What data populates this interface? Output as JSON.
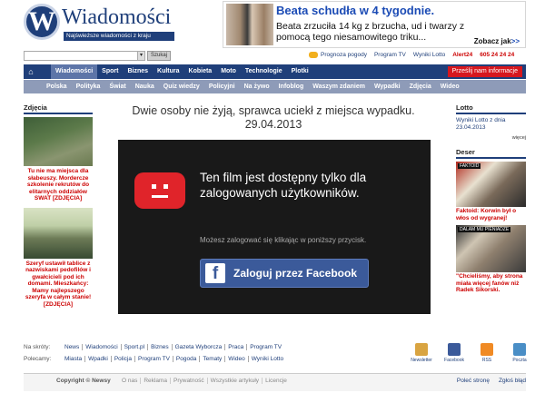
{
  "logo": {
    "letter": "W",
    "name": "Wiadomości",
    "tagline": "Najświeższe wiadomości z kraju"
  },
  "ad": {
    "title": "Beata schudła w 4 tygodnie.",
    "text": "Beata zrzuciła 14 kg z brzucha, ud i twarzy z pomocą tego niesamowitego triku...",
    "more_label": "Zobacz jak",
    "more_arrow": ">>"
  },
  "search": {
    "value": "",
    "button": "Szukaj",
    "dropdown_arrow": "▾"
  },
  "toplinks": [
    "Prognoza pogody",
    "Program TV",
    "Wyniki Lotto"
  ],
  "alert": {
    "label": "Alert24",
    "phone": "605 24 24 24"
  },
  "nav": {
    "home_icon": "home-icon",
    "items": [
      "Wiadomości",
      "Sport",
      "Biznes",
      "Kultura",
      "Kobieta",
      "Moto",
      "Technologie",
      "Plotki"
    ],
    "active": "Wiadomości",
    "report": "Prześlij nam informacje"
  },
  "subnav": [
    "Polska",
    "Polityka",
    "Świat",
    "Nauka",
    "Quiz wiedzy",
    "Policyjni",
    "Na żywo",
    "Infoblog",
    "Waszym zdaniem",
    "Wypadki",
    "Zdjęcia",
    "Wideo"
  ],
  "left": {
    "title": "Zdjęcia",
    "items": [
      "Tu nie ma miejsca dla słabeuszy. Mordercze szkolenie rekrutów do elitarnych oddziałów SWAT [ZDJĘCIA]",
      "Szeryf ustawił tablice z nazwiskami pedofilów i gwałcicieli pod ich domami. Mieszkańcy: Mamy najlepszego szeryfa w całym stanie! [ZDJĘCIA]"
    ]
  },
  "main": {
    "headline": "Dwie osoby nie żyją, sprawca uciekł z miejsca wypadku. 29.04.2013",
    "player": {
      "message": "Ten film jest dostępny tylko dla zalogowanych użytkowników.",
      "sub": "Możesz zalogować się klikając w poniższy przycisk.",
      "fb_letter": "f",
      "fb_button": "Zaloguj przez Facebook"
    }
  },
  "right": {
    "lotto_title": "Lotto",
    "lotto_link": "Wyniki Lotto z dnia 23.04.2013",
    "more": "więcej",
    "deser_title": "Deser",
    "items": [
      {
        "badge": "FAKTOID",
        "caption": "Faktoid: Korwin był o włos od wygranej!"
      },
      {
        "badge": "DALAM MU PIENIADZE",
        "caption": "\"Chcieliśmy, aby strona miała więcej fanów niż Radek Sikorski."
      }
    ]
  },
  "footer": {
    "skroty_label": "Na skróty:",
    "skroty": [
      "News",
      "Wiadomości",
      "Sport.pl",
      "Biznes",
      "Gazeta Wyborcza",
      "Praca",
      "Program TV"
    ],
    "polecamy_label": "Polecamy:",
    "polecamy": [
      "Miasta",
      "Wpadki",
      "Policja",
      "Program TV",
      "Pogoda",
      "Tematy",
      "Wideo",
      "Wyniki Lotto"
    ],
    "icons": [
      {
        "label": "Newsletter",
        "color": "#d9a441"
      },
      {
        "label": "Facebook",
        "color": "#3b5a9a"
      },
      {
        "label": "RSS",
        "color": "#f08a24"
      },
      {
        "label": "Poczta",
        "color": "#4a8ec6"
      }
    ]
  },
  "bottom": {
    "copyright": "Copyright © Newsy",
    "links": [
      "O nas",
      "Reklama",
      "Prywatność",
      "Wszystkie artykuły",
      "Licencje"
    ],
    "right_links": [
      "Poleć stronę",
      "Zgłoś błąd"
    ]
  }
}
